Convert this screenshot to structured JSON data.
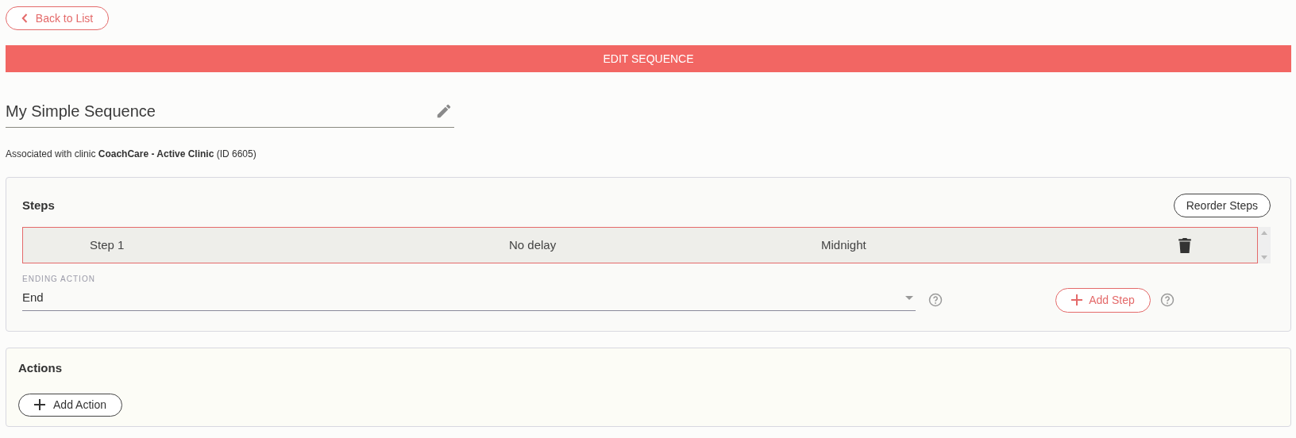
{
  "back_button": {
    "label": "Back to List"
  },
  "banner": {
    "title": "EDIT SEQUENCE"
  },
  "sequence_name": {
    "value": "My Simple Sequence"
  },
  "association": {
    "text": "Associated with clinic **CoachCare - Active Clinic** (ID 6605)"
  },
  "steps_card": {
    "title": "Steps",
    "reorder_button": "Reorder Steps",
    "rows": [
      {
        "name": "Step 1",
        "delay": "No delay",
        "time": "Midnight",
        "selected": true
      }
    ],
    "ending_action": {
      "label": "ENDING ACTION",
      "value": "End"
    },
    "add_step_button": "Add Step"
  },
  "actions_card": {
    "title": "Actions",
    "add_action_button": "Add Action"
  }
}
